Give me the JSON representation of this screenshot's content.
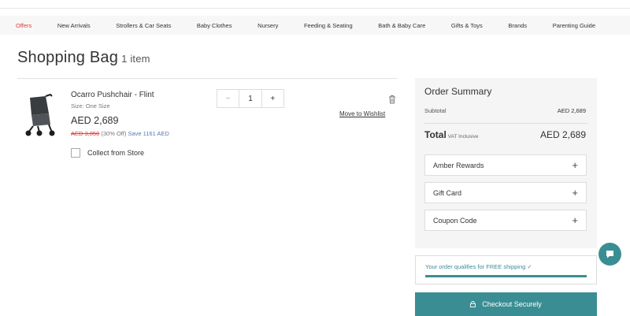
{
  "nav": {
    "items": [
      {
        "label": "Offers",
        "active": true
      },
      {
        "label": "New Arrivals"
      },
      {
        "label": "Strollers & Car Seats"
      },
      {
        "label": "Baby Clothes"
      },
      {
        "label": "Nursery"
      },
      {
        "label": "Feeding & Seating"
      },
      {
        "label": "Bath & Baby Care"
      },
      {
        "label": "Gifts & Toys"
      },
      {
        "label": "Brands"
      },
      {
        "label": "Parenting Guide"
      }
    ]
  },
  "page": {
    "title": "Shopping Bag",
    "item_count": "1 item"
  },
  "product": {
    "name": "Ocarro Pushchair - Flint",
    "size": "Size: One Size",
    "price": "AED 2,689",
    "old_price": "AED 3,850",
    "discount": "(30% Off)",
    "save": "Save 1161 AED",
    "quantity": "1",
    "minus_label": "−",
    "plus_label": "+",
    "move_to_wishlist": "Move to Wishlist",
    "collect_label": "Collect from Store",
    "image_icon": "stroller-icon",
    "delete_icon": "trash-icon"
  },
  "summary": {
    "title": "Order Summary",
    "subtotal_label": "Subtotal",
    "subtotal_value": "AED 2,689",
    "total_label": "Total",
    "vat_label": "VAT Inclusive",
    "total_value": "AED 2,689",
    "accordions": [
      {
        "label": "Amber Rewards",
        "icon": "+"
      },
      {
        "label": "Gift Card",
        "icon": "+"
      },
      {
        "label": "Coupon Code",
        "icon": "+"
      }
    ]
  },
  "shipping": {
    "text": "Your order qualifies for FREE shipping ✓",
    "progress": 1.0
  },
  "checkout": {
    "label": "Checkout Securely",
    "icon": "lock-icon"
  },
  "chat": {
    "icon": "chat-icon"
  },
  "colors": {
    "accent": "#3a8e93",
    "offer_red": "#e53935",
    "save_blue": "#5a77b5"
  }
}
